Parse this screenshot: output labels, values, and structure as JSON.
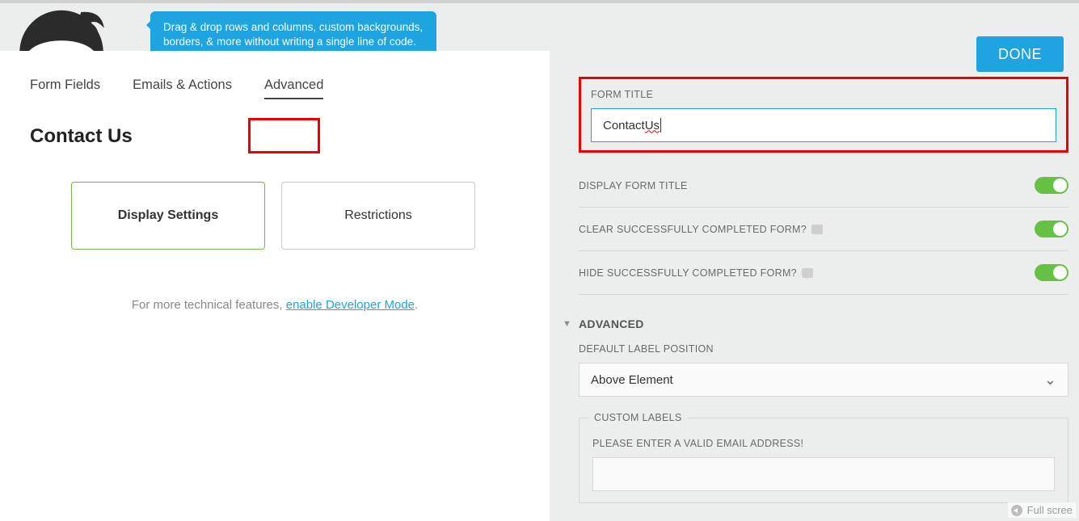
{
  "tooltip": "Drag & drop rows and columns, custom backgrounds, borders, & more without writing a single line of code.",
  "done_label": "DONE",
  "nav": {
    "form_fields": "Form Fields",
    "emails_actions": "Emails & Actions",
    "advanced": "Advanced"
  },
  "page_heading": "Contact Us",
  "cards": {
    "display_settings": "Display Settings",
    "restrictions": "Restrictions"
  },
  "dev_note_pre": "For more technical features, ",
  "dev_note_link": "enable Developer Mode",
  "dev_note_post": ".",
  "panel": {
    "form_title_label": "FORM TITLE",
    "form_title_value_pre": "Contact ",
    "form_title_value_err": "Us",
    "display_form_title": "DISPLAY FORM TITLE",
    "clear_form": "CLEAR SUCCESSFULLY COMPLETED FORM?",
    "hide_form": "HIDE SUCCESSFULLY COMPLETED FORM?",
    "advanced_section": "ADVANCED",
    "default_label_pos": "DEFAULT LABEL POSITION",
    "default_label_pos_value": "Above Element",
    "custom_labels": "CUSTOM LABELS",
    "email_error_label": "PLEASE ENTER A VALID EMAIL ADDRESS!",
    "email_error_value": ""
  },
  "fullscreen": "Full scree"
}
